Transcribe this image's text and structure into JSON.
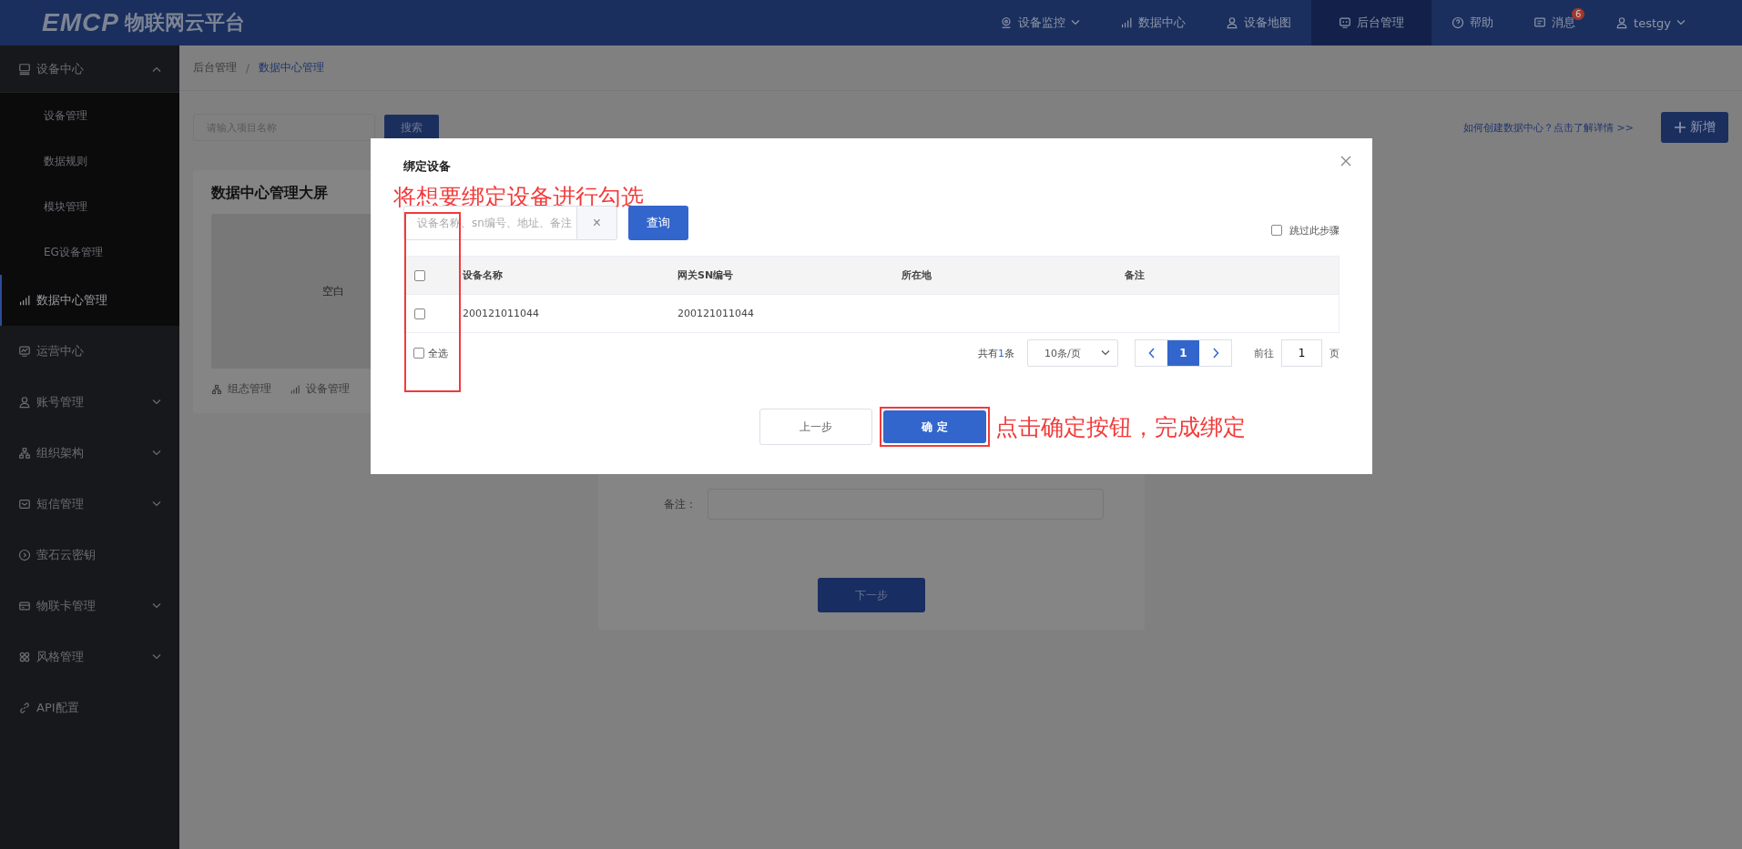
{
  "header": {
    "logo_mark": "EMCP",
    "logo_text": "物联网云平台",
    "nav": [
      {
        "label": "设备监控",
        "caret": true,
        "selected": false
      },
      {
        "label": "数据中心",
        "caret": false,
        "selected": false
      },
      {
        "label": "设备地图",
        "caret": false,
        "selected": false
      },
      {
        "label": "后台管理",
        "caret": false,
        "selected": true
      },
      {
        "label": "帮助",
        "caret": false,
        "selected": false
      },
      {
        "label": "消息",
        "caret": false,
        "selected": false,
        "badge": "6"
      },
      {
        "label": "testgy",
        "caret": true,
        "selected": false
      }
    ]
  },
  "sidebar": {
    "items": [
      {
        "label": "设备中心",
        "expanded": true,
        "selected": false,
        "children": [
          {
            "label": "设备管理",
            "selected": false
          },
          {
            "label": "数据规则",
            "selected": false
          },
          {
            "label": "模块管理",
            "selected": false
          },
          {
            "label": "EG设备管理",
            "selected": false
          }
        ]
      },
      {
        "label": "数据中心管理",
        "selected": true
      },
      {
        "label": "运营中心",
        "selected": false
      },
      {
        "label": "账号管理",
        "expanded": false,
        "selected": false
      },
      {
        "label": "组织架构",
        "expanded": false,
        "selected": false
      },
      {
        "label": "短信管理",
        "expanded": false,
        "selected": false
      },
      {
        "label": "萤石云密钥",
        "selected": false
      },
      {
        "label": "物联卡管理",
        "expanded": false,
        "selected": false
      },
      {
        "label": "风格管理",
        "expanded": false,
        "selected": false
      },
      {
        "label": "API配置",
        "selected": false
      }
    ]
  },
  "breadcrumb": {
    "separator": "/",
    "items": [
      "后台管理",
      "数据中心管理"
    ]
  },
  "toolbar": {
    "search_placeholder": "请输入项目名称",
    "search_button": "搜索",
    "help_link": "如何创建数据中心？点击了解详情 >>",
    "add_button": "新增"
  },
  "card": {
    "title": "数据中心管理大屏",
    "preview": "空白",
    "actions": [
      "组态管理",
      "设备管理"
    ]
  },
  "form": {
    "note_label": "备注：",
    "next_button": "下一步"
  },
  "dialog": {
    "title": "绑定设备",
    "search_placeholder": "设备名称、sn编号、地址、备注",
    "clear": "×",
    "query_button": "查询",
    "skip": {
      "label": "跳过此步骤",
      "checked": false
    },
    "table": {
      "header_checked": false,
      "columns": [
        "设备名称",
        "网关SN编号",
        "所在地",
        "备注"
      ],
      "rows": [
        {
          "checked": false,
          "cells": [
            "200121011044",
            "200121011044",
            "",
            ""
          ]
        }
      ]
    },
    "select_all": {
      "label": "全选",
      "checked": false
    },
    "pagination": {
      "total_prefix": "共有",
      "total_count": "1",
      "total_suffix": "条",
      "page_size": "10条/页",
      "pages": [
        {
          "label": "1",
          "selected": true
        }
      ],
      "goto_prefix": "前往",
      "goto_value": "1",
      "goto_suffix": "页"
    },
    "prev_button": "上一步",
    "confirm_button": "确 定"
  },
  "annotations": {
    "select_hint": "将想要绑定设备进行勾选",
    "confirm_hint": "点击确定按钮，完成绑定"
  }
}
